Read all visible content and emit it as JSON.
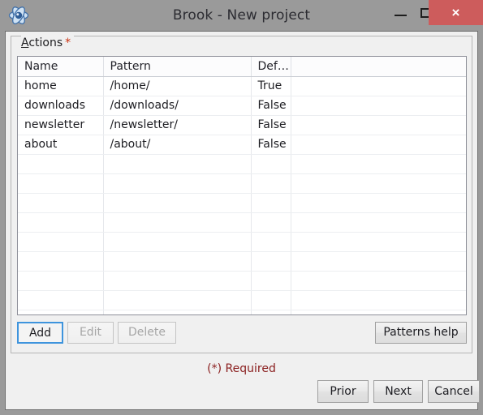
{
  "window": {
    "title": "Brook - New project",
    "app_icon": "brook-atom-icon",
    "controls": {
      "minimize": "minimize-icon",
      "maximize": "maximize-icon",
      "close": "×"
    },
    "close_color": "#cd5c5c",
    "titlebar_color": "#9a9a9a"
  },
  "group": {
    "label_accel": "A",
    "label_rest": "ctions",
    "required_star": "*"
  },
  "table": {
    "columns": [
      "Name",
      "Pattern",
      "Def…",
      ""
    ],
    "rows": [
      {
        "name": "home",
        "pattern": "/home/",
        "default": "True"
      },
      {
        "name": "downloads",
        "pattern": "/downloads/",
        "default": "False"
      },
      {
        "name": "newsletter",
        "pattern": "/newsletter/",
        "default": "False"
      },
      {
        "name": "about",
        "pattern": "/about/",
        "default": "False"
      }
    ],
    "empty_row_count": 9
  },
  "actions": {
    "add": "Add",
    "edit": "Edit",
    "delete": "Delete",
    "patterns_help": "Patterns help"
  },
  "footer": {
    "required_note": "(*) Required",
    "required_color": "#8b2020",
    "prior": "Prior",
    "next": "Next",
    "cancel": "Cancel"
  }
}
